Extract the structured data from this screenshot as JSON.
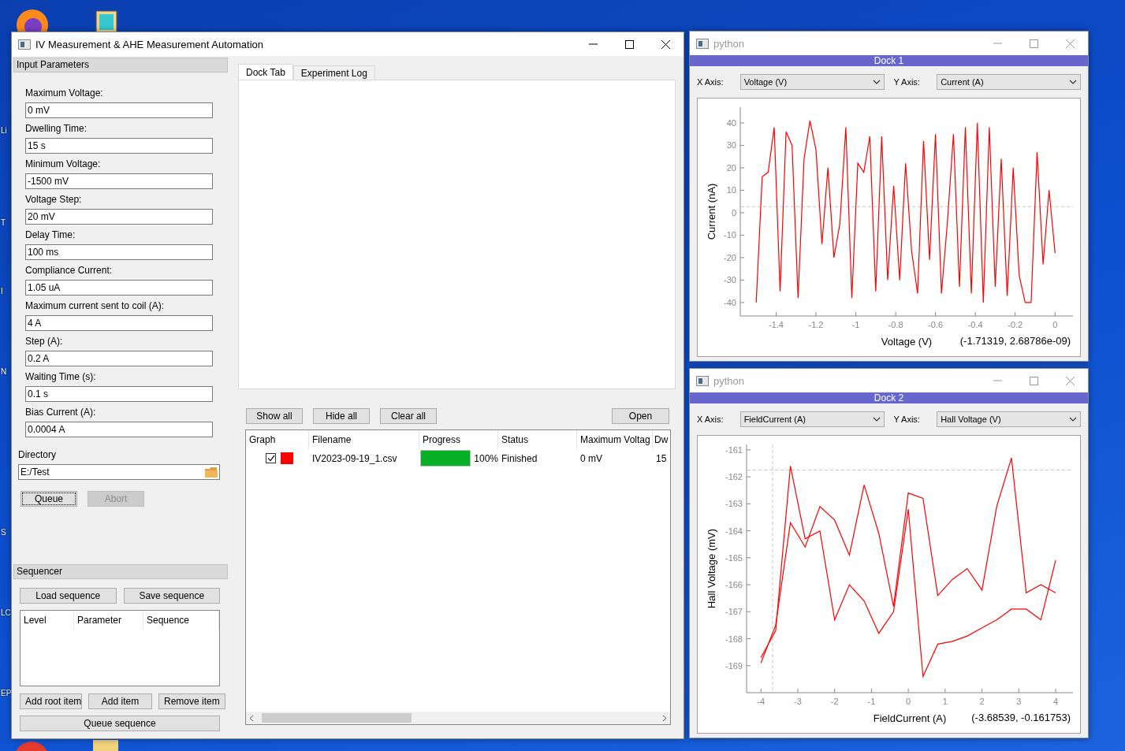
{
  "desktop": {
    "edge_labels": [
      "Li",
      "T",
      "I",
      "N",
      "S",
      "LC",
      "EP"
    ]
  },
  "main_window": {
    "title": "IV Measurement & AHE Measurement Automation",
    "input_parameters": {
      "title": "Input Parameters",
      "fields": [
        {
          "label": "Maximum Voltage:",
          "value": "0 mV"
        },
        {
          "label": "Dwelling Time:",
          "value": "15 s"
        },
        {
          "label": "Minimum Voltage:",
          "value": "-1500 mV"
        },
        {
          "label": "Voltage Step:",
          "value": "20 mV"
        },
        {
          "label": "Delay Time:",
          "value": "100 ms"
        },
        {
          "label": "Compliance Current:",
          "value": "1.05 uA"
        },
        {
          "label": "Maximum current sent to coil (A):",
          "value": "4 A"
        },
        {
          "label": "Step (A):",
          "value": "0.2 A"
        },
        {
          "label": "Waiting Time (s):",
          "value": "0.1 s"
        },
        {
          "label": "Bias Current (A):",
          "value": "0.0004 A"
        }
      ],
      "directory": {
        "label": "Directory",
        "value": "E:/Test"
      },
      "buttons": [
        {
          "label": "Queue",
          "disabled": false,
          "focused": true
        },
        {
          "label": "Abort",
          "disabled": true,
          "focused": false
        }
      ]
    },
    "sequencer": {
      "title": "Sequencer",
      "top_buttons": [
        "Load sequence",
        "Save sequence"
      ],
      "columns": [
        "Level",
        "Parameter",
        "Sequence"
      ],
      "item_buttons": [
        "Add root item",
        "Add item",
        "Remove item"
      ],
      "queue_button": "Queue sequence"
    },
    "tabs": [
      {
        "label": "Dock Tab",
        "selected": true
      },
      {
        "label": "Experiment Log",
        "selected": false
      }
    ],
    "file_buttons": [
      "Show all",
      "Hide all",
      "Clear all"
    ],
    "open_button": "Open",
    "table": {
      "columns": [
        "Graph",
        "Filename",
        "Progress",
        "Status",
        "Maximum Voltag",
        "Dw"
      ],
      "rows": [
        {
          "shown": true,
          "color": "#ff0000",
          "filename": "IV2023-09-19_1.csv",
          "level": 1,
          "progress": "100%",
          "status": "Finished",
          "maximum_voltage": "0 mV",
          "column_6": "15"
        }
      ]
    }
  },
  "docks": [
    {
      "window_title": "python",
      "dock_title": "Dock 1",
      "x_axis_label": "X Axis:",
      "x_axis": "Voltage (V)",
      "y_axis_label": "Y Axis:",
      "y_axis": "Current (A)",
      "cursor": "(-1.71319, 2.68786e-09)",
      "chart_data": {
        "type": "line",
        "xlabel": "Voltage (V)",
        "ylabel": "Current (nA)",
        "xlim": [
          -1.58,
          0.09
        ],
        "ylim": [
          -46,
          47
        ],
        "xticks": [
          -1.4,
          -1.2,
          -1,
          -0.8,
          -0.6,
          -0.4,
          -0.2,
          0
        ],
        "yticks": [
          -40,
          -30,
          -20,
          -10,
          0,
          10,
          20,
          30,
          40
        ],
        "x": [
          -1.5,
          -1.47,
          -1.44,
          -1.41,
          -1.38,
          -1.35,
          -1.32,
          -1.29,
          -1.26,
          -1.23,
          -1.2,
          -1.17,
          -1.14,
          -1.11,
          -1.08,
          -1.05,
          -1.02,
          -0.99,
          -0.96,
          -0.93,
          -0.9,
          -0.87,
          -0.84,
          -0.81,
          -0.78,
          -0.75,
          -0.72,
          -0.69,
          -0.66,
          -0.63,
          -0.6,
          -0.57,
          -0.54,
          -0.51,
          -0.48,
          -0.45,
          -0.42,
          -0.39,
          -0.36,
          -0.33,
          -0.3,
          -0.27,
          -0.24,
          -0.21,
          -0.18,
          -0.15,
          -0.12,
          -0.09,
          -0.06,
          -0.03,
          0
        ],
        "series": [
          {
            "color": "#ff0000",
            "values": [
              -40,
              16,
              18,
              38,
              -35,
              36,
              30,
              -38,
              24,
              41,
              28,
              -14,
              20,
              -20,
              -5,
              38,
              -38,
              22,
              18,
              34,
              -35,
              34,
              -30,
              12,
              -30,
              22,
              -17,
              -36,
              32,
              -21,
              35,
              -36,
              -4,
              35,
              -33,
              38,
              -36,
              40,
              -40,
              38,
              -33,
              24,
              -37,
              20,
              -28,
              -40,
              -40,
              27,
              -23,
              10,
              -18
            ]
          }
        ],
        "ref_lines": [
          {
            "axis": "y",
            "value": 2.69
          }
        ]
      }
    },
    {
      "window_title": "python",
      "dock_title": "Dock 2",
      "x_axis_label": "X Axis:",
      "x_axis": "FieldCurrent (A)",
      "y_axis_label": "Y Axis:",
      "y_axis": "Hall Voltage (V)",
      "cursor": "(-3.68539, -0.161753)",
      "chart_data": {
        "type": "line",
        "xlabel": "FieldCurrent (A)",
        "ylabel": "Hall Voltage (mV)",
        "xlim": [
          -4.39,
          4.47
        ],
        "ylim": [
          -170,
          -160.8
        ],
        "xticks": [
          -4,
          -3,
          -2,
          -1,
          0,
          1,
          2,
          3,
          4
        ],
        "yticks": [
          -169,
          -168,
          -167,
          -166,
          -165,
          -164,
          -163,
          -162,
          -161
        ],
        "x": [
          -4,
          -3.6,
          -3.2,
          -2.8,
          -2.4,
          -2,
          -1.6,
          -1.2,
          -0.8,
          -0.4,
          0,
          0.4,
          0.8,
          1.2,
          1.6,
          2,
          2.4,
          2.8,
          3.2,
          3.6,
          4
        ],
        "series": [
          {
            "color": "#ff0000",
            "values": [
              -168.9,
              -167.5,
              -163.7,
              -164.6,
              -163.1,
              -163.6,
              -164.9,
              -162.3,
              -164.1,
              -166.8,
              -162.6,
              -162.8,
              -166.4,
              -165.8,
              -165.4,
              -166.2,
              -163.1,
              -161.3,
              -166.3,
              -166.0,
              -166.3
            ]
          },
          {
            "color": "#ff0000",
            "values": [
              -168.7,
              -167.7,
              -161.6,
              -164.3,
              -164.0,
              -167.3,
              -166.0,
              -166.6,
              -167.8,
              -167.0,
              -163.2,
              -169.4,
              -168.2,
              -168.1,
              -167.9,
              -167.6,
              -167.3,
              -166.9,
              -166.9,
              -167.3,
              -165.1
            ]
          }
        ],
        "ref_lines": [
          {
            "axis": "x",
            "value": -3.685
          },
          {
            "axis": "y",
            "value": -161.75
          }
        ]
      }
    }
  ]
}
